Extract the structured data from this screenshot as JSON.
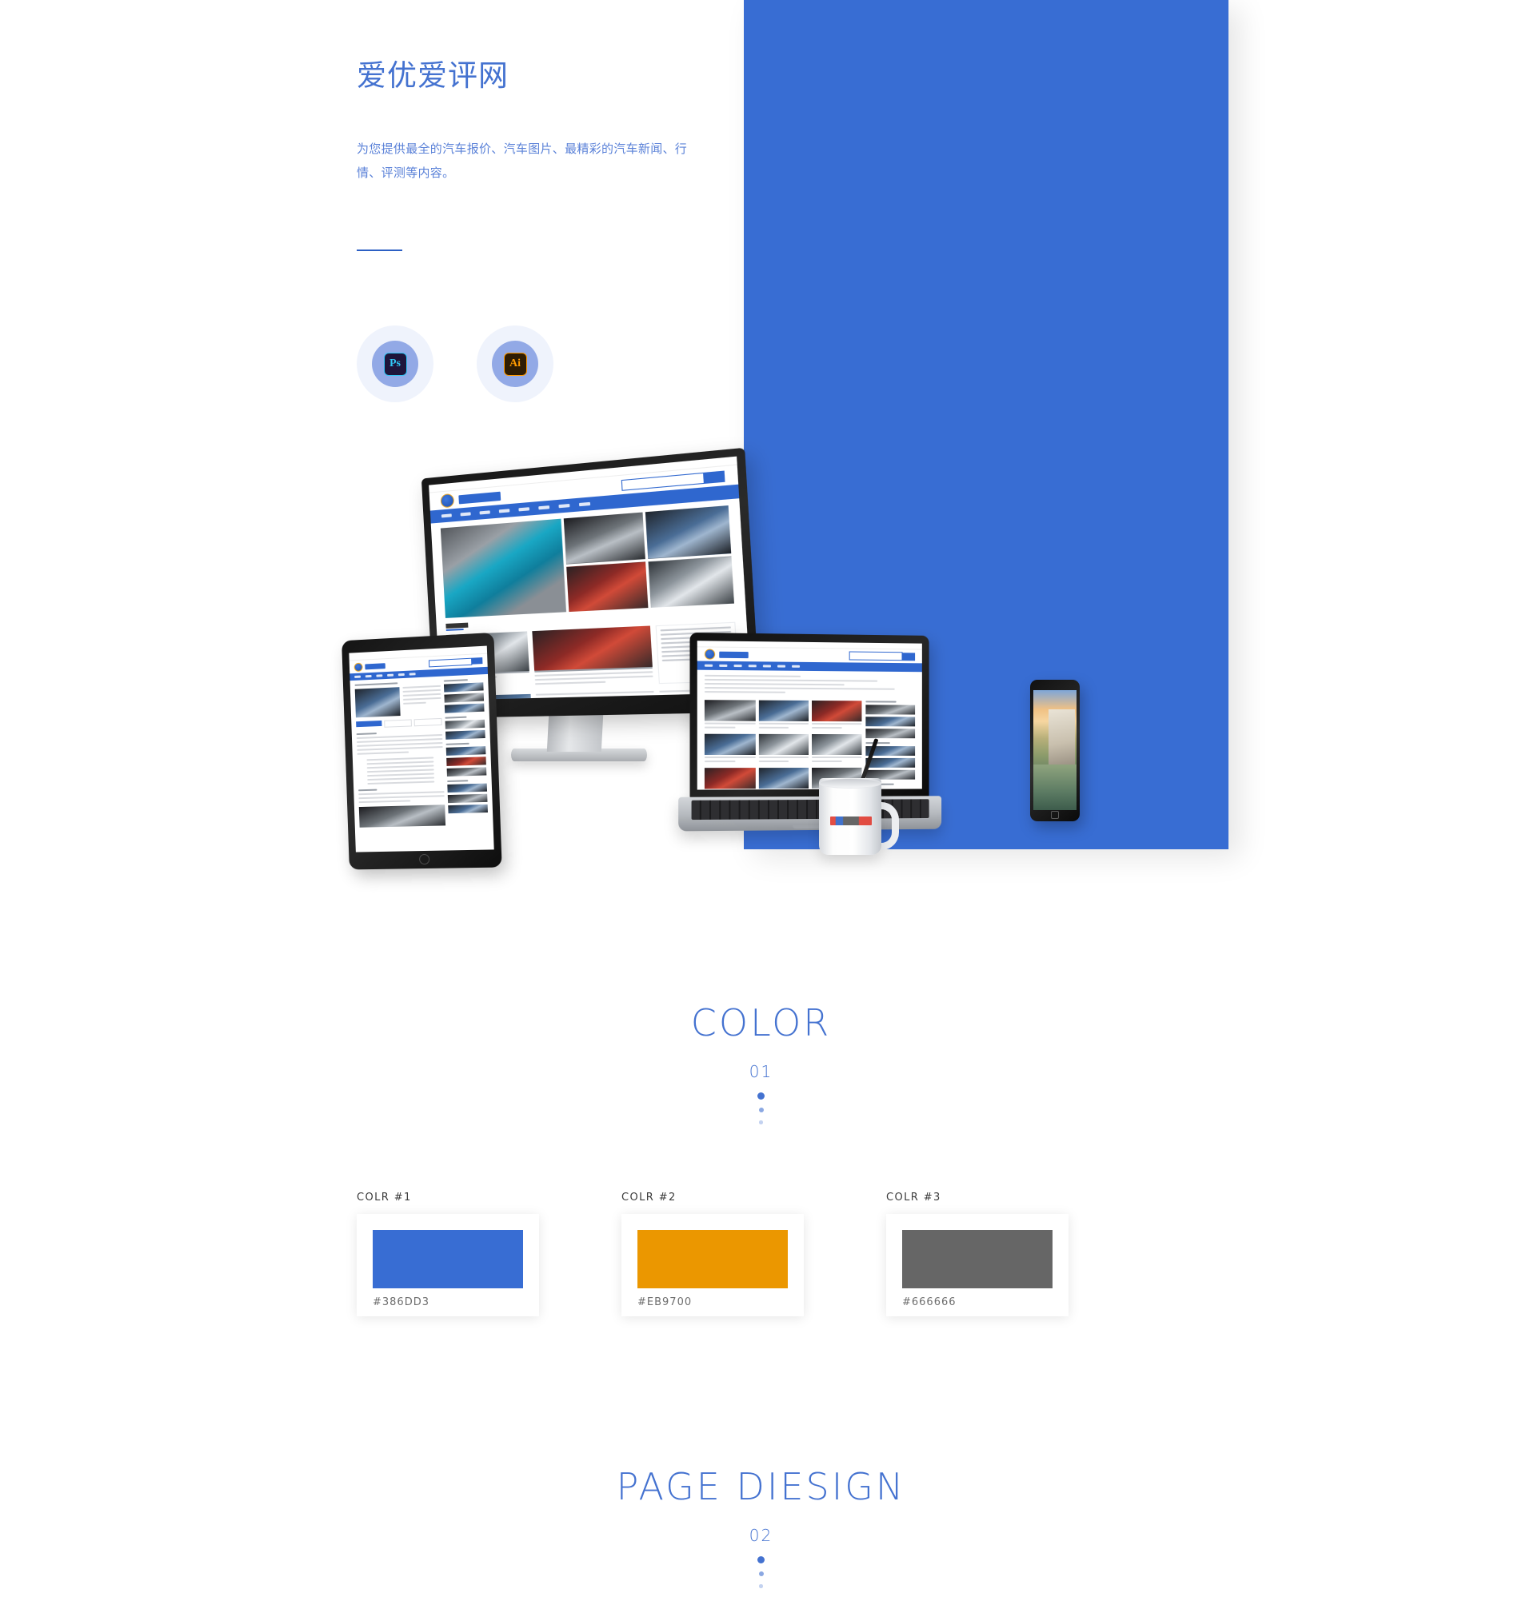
{
  "hero": {
    "brand_title": "爱优爱评网",
    "brand_description": "为您提供最全的汽车报价、汽车图片、最精彩的汽车新闻、行情、评测等内容。",
    "tools": [
      {
        "name": "Photoshop",
        "abbr": "Ps"
      },
      {
        "name": "Illustrator",
        "abbr": "Ai"
      }
    ],
    "panel_color": "#386DD3"
  },
  "sections": [
    {
      "title": "COLOR",
      "number": "01"
    },
    {
      "title": "PAGE DIESIGN",
      "number": "02"
    }
  ],
  "colors": [
    {
      "label": "COLR #1",
      "hex": "#386DD3"
    },
    {
      "label": "COLR #2",
      "hex": "#EB9700"
    },
    {
      "label": "COLR #3",
      "hex": "#666666"
    }
  ],
  "accent": "#4472D0"
}
